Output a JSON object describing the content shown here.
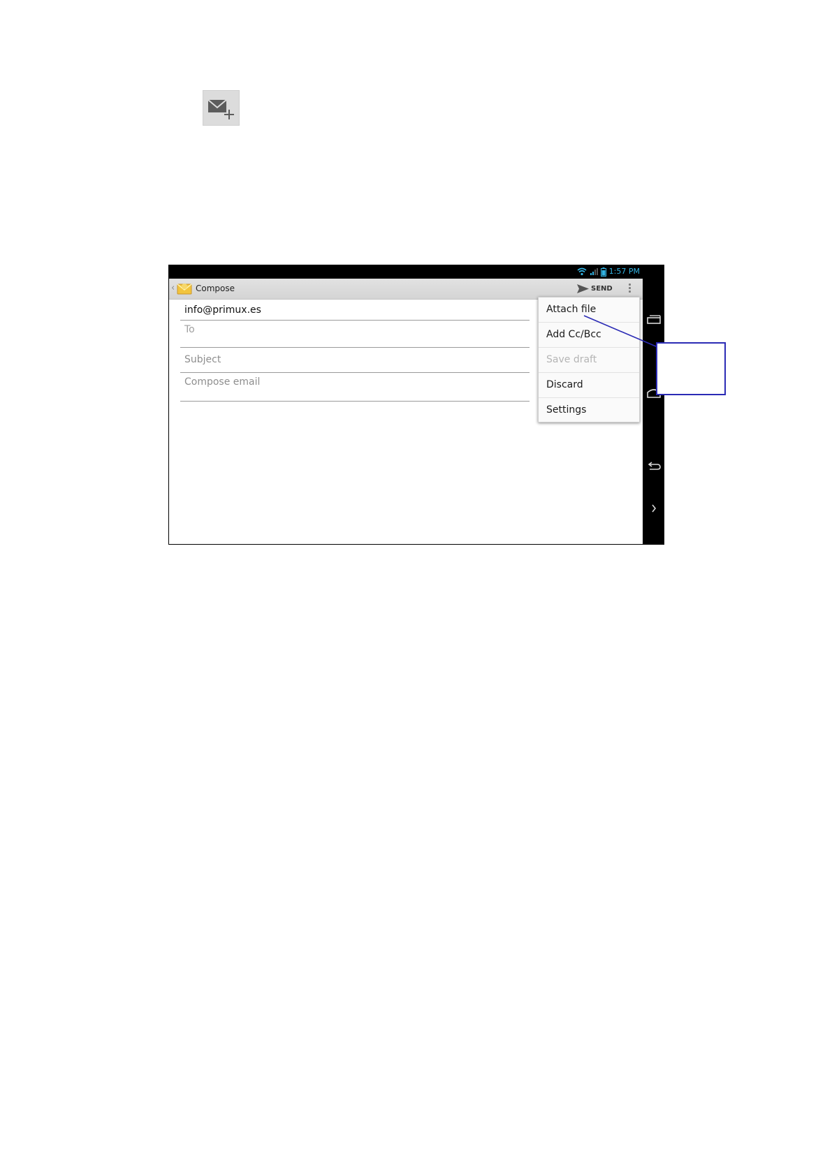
{
  "top_icon": {
    "name": "new-mail-icon"
  },
  "status_bar": {
    "time": "1:57 PM"
  },
  "action_bar": {
    "title": "Compose",
    "send_label": "SEND"
  },
  "compose": {
    "from": "info@primux.es",
    "to_placeholder": "To",
    "subject_placeholder": "Subject",
    "body_placeholder": "Compose email"
  },
  "menu": {
    "items": [
      {
        "label": "Attach file",
        "enabled": true
      },
      {
        "label": "Add Cc/Bcc",
        "enabled": true
      },
      {
        "label": "Save draft",
        "enabled": false
      },
      {
        "label": "Discard",
        "enabled": true
      },
      {
        "label": "Settings",
        "enabled": true
      }
    ]
  },
  "colors": {
    "callout": "#2b2bb5",
    "status_text": "#33b5e5",
    "action_bar": "#d9d9d9"
  }
}
